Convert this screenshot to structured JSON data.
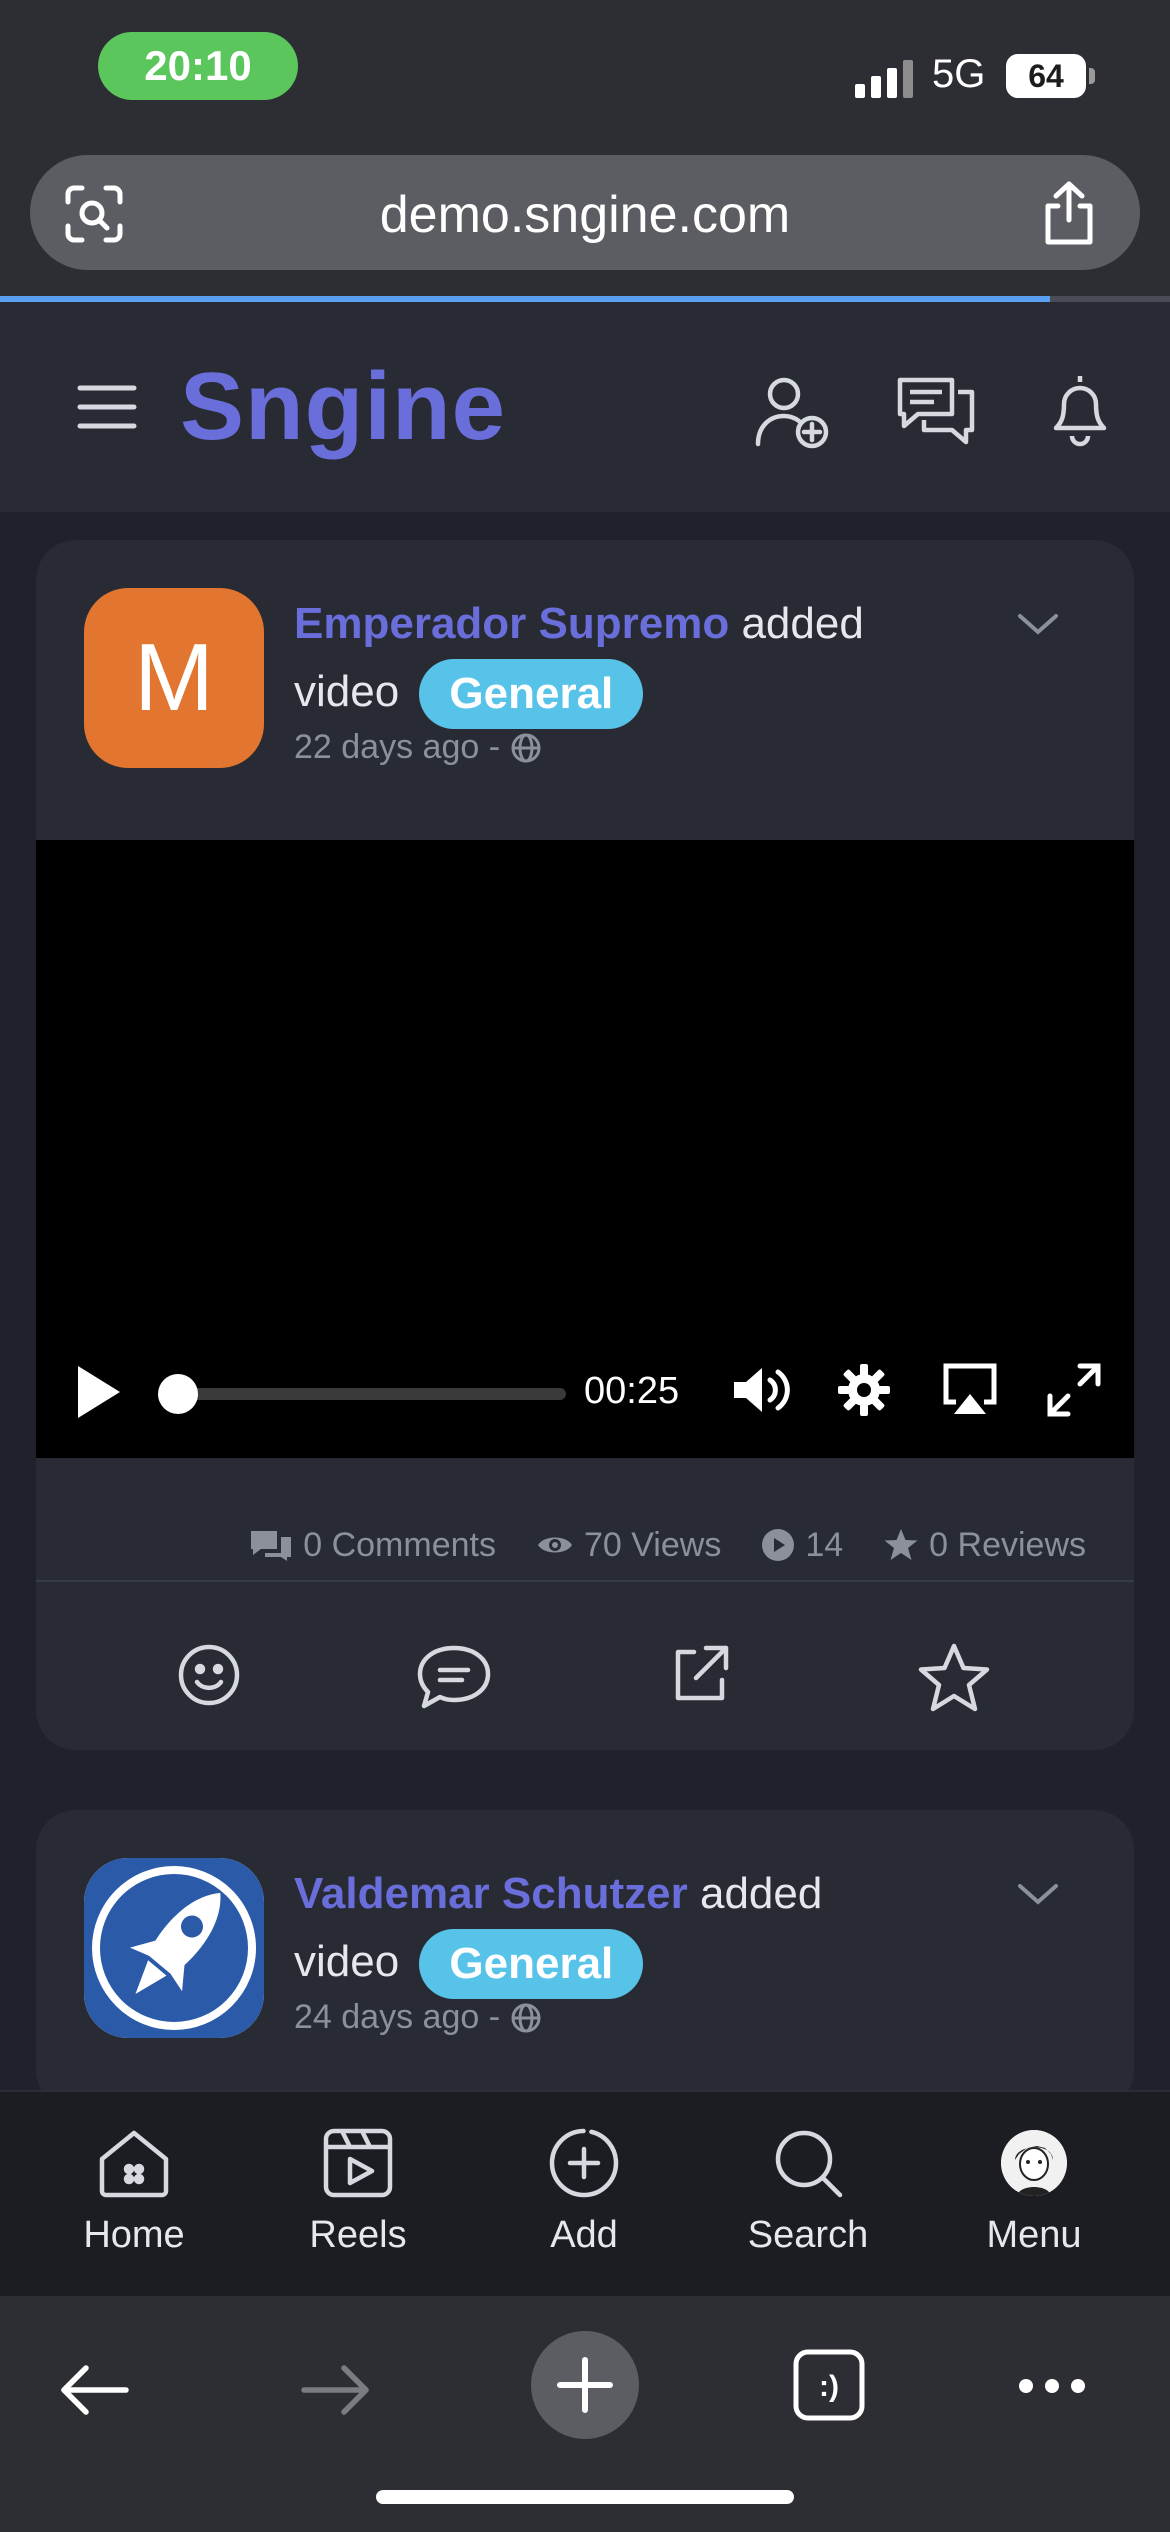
{
  "status_bar": {
    "time": "20:10",
    "network": "5G",
    "battery": "64"
  },
  "browser": {
    "url": "demo.sngine.com"
  },
  "app": {
    "logo": "Sngine"
  },
  "posts": [
    {
      "author": "Emperador Supremo",
      "action": "added",
      "object": "video",
      "category": "General",
      "time": "22 days ago -",
      "avatar_letter": "M",
      "video": {
        "time_display": "00:25",
        "progress": 0.0
      },
      "stats": {
        "comments": "0 Comments",
        "views": "70 Views",
        "plays": "14",
        "reviews": "0 Reviews"
      }
    },
    {
      "author": "Valdemar Schutzer",
      "action": "added",
      "object": "video",
      "category": "General",
      "time": "24 days ago -"
    }
  ],
  "bottom_nav": [
    {
      "label": "Home",
      "icon": "home-icon"
    },
    {
      "label": "Reels",
      "icon": "reels-icon"
    },
    {
      "label": "Add",
      "icon": "add-icon"
    },
    {
      "label": "Search",
      "icon": "search-icon"
    },
    {
      "label": "Menu",
      "icon": "avatar"
    }
  ],
  "colors": {
    "accent": "#6a6edb",
    "badge": "#58c3e8",
    "avatar_orange": "#e27530",
    "status_pill": "#5bc65c"
  }
}
